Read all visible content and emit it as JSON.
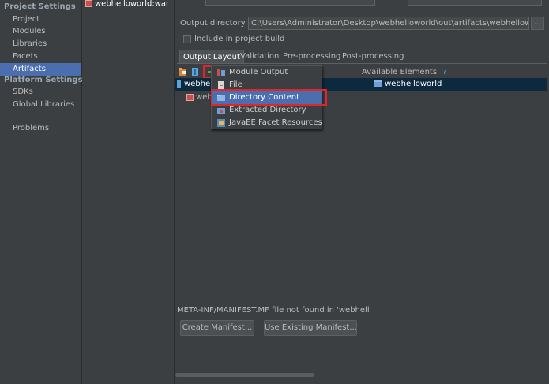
{
  "sidebar": {
    "project_settings_header": "Project Settings",
    "project_items": [
      "Project",
      "Modules",
      "Libraries",
      "Facets",
      "Artifacts"
    ],
    "selected_item": "Artifacts",
    "platform_settings_header": "Platform Settings",
    "platform_items": [
      "SDKs",
      "Global Libraries"
    ],
    "problems": "Problems"
  },
  "artifact_list": {
    "items": [
      "webhelloworld:war"
    ]
  },
  "artifact": {
    "output_directory_label": "Output directory:",
    "output_directory_value": "C:\\Users\\Administrator\\Desktop\\webhelloworld\\out\\artifacts\\webhelloworld",
    "browse_label": "...",
    "include_in_build_label": "Include in project build",
    "include_in_build_checked": false
  },
  "tabs": [
    "Output Layout",
    "Validation",
    "Pre-processing",
    "Post-processing"
  ],
  "active_tab": "Output Layout",
  "layout": {
    "toolbar_icons": [
      "new-folder-icon",
      "archive-icon",
      "add-icon"
    ],
    "tree_rows": [
      "webhell",
      "web"
    ],
    "available_elements_label": "Available Elements",
    "available_help": "?",
    "available_items": [
      "webhelloworld"
    ]
  },
  "add_menu": {
    "items": [
      {
        "label": "Module Output",
        "icon": "module-output-icon"
      },
      {
        "label": "File",
        "icon": "file-icon"
      },
      {
        "label": "Directory Content",
        "icon": "directory-content-icon"
      },
      {
        "label": "Extracted Directory",
        "icon": "extracted-directory-icon"
      },
      {
        "label": "JavaEE Facet Resources",
        "icon": "javaee-facet-icon"
      }
    ],
    "selected": "Directory Content"
  },
  "manifest": {
    "warning": "META-INF/MANIFEST.MF file not found in 'webhell",
    "create_button": "Create Manifest...",
    "use_existing_button": "Use Existing Manifest..."
  },
  "colors": {
    "background": "#3c3f41",
    "selection": "#4b6eaf",
    "highlight_box": "#e0262b"
  }
}
